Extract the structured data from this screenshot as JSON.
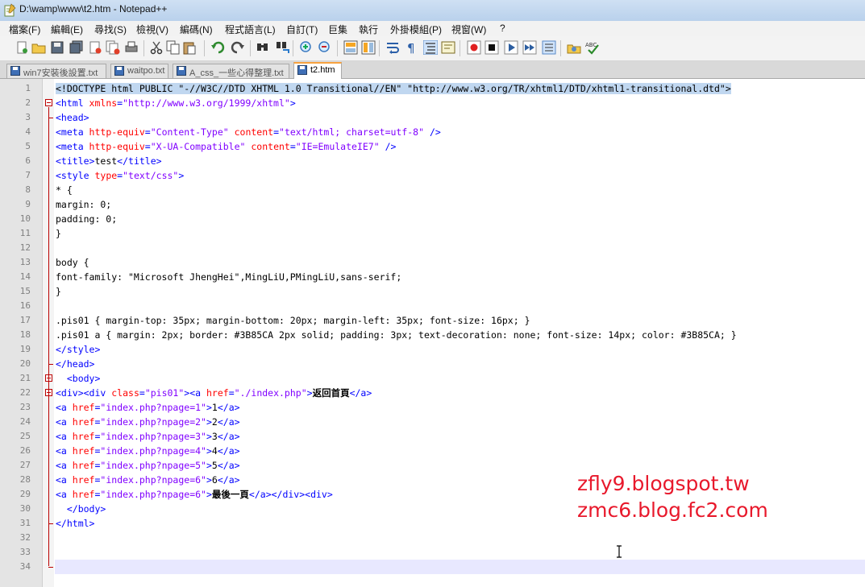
{
  "window": {
    "title": "D:\\wamp\\www\\t2.htm - Notepad++"
  },
  "menu": [
    "檔案(F)",
    "編輯(E)",
    "尋找(S)",
    "檢視(V)",
    "編碼(N)",
    "程式語言(L)",
    "自訂(T)",
    "巨集",
    "執行",
    "外掛模組(P)",
    "視窗(W)",
    "?"
  ],
  "tabs": [
    {
      "label": "win7安裝後設置.txt",
      "active": false
    },
    {
      "label": "waitpo.txt",
      "active": false
    },
    {
      "label": "A_css_一些心得整理.txt",
      "active": false
    },
    {
      "label": "t2.htm",
      "active": true
    }
  ],
  "toolbar_icons": [
    "new-file-icon",
    "open-file-icon",
    "save-icon",
    "save-all-icon",
    "close-icon",
    "close-all-icon",
    "print-icon",
    "cut-icon",
    "copy-icon",
    "paste-icon",
    "undo-icon",
    "redo-icon",
    "find-icon",
    "replace-icon",
    "zoom-in-icon",
    "zoom-out-icon",
    "sync-vertical-icon",
    "sync-horizontal-icon",
    "word-wrap-icon",
    "show-all-chars-icon",
    "indent-guide-icon",
    "user-defined-lang-icon",
    "record-macro-icon",
    "stop-macro-icon",
    "play-macro-icon",
    "run-macro-multiple-icon",
    "save-macro-icon",
    "launch-browser-icon",
    "spell-check-icon"
  ],
  "editor": {
    "lines": [
      [
        {
          "c": "sel",
          "t": "<!DOCTYPE html PUBLIC \"-//W3C//DTD XHTML 1.0 Transitional//EN\" \"http://www.w3.org/TR/xhtml1/DTD/xhtml1-transitional.dtd\">"
        }
      ],
      [
        {
          "c": "tag",
          "t": "<html "
        },
        {
          "c": "attr",
          "t": "xmlns"
        },
        {
          "c": "tag",
          "t": "="
        },
        {
          "c": "val",
          "t": "\"http://www.w3.org/1999/xhtml\""
        },
        {
          "c": "tag",
          "t": ">"
        }
      ],
      [
        {
          "c": "tag",
          "t": "<head>"
        }
      ],
      [
        {
          "c": "tag",
          "t": "<meta "
        },
        {
          "c": "attr",
          "t": "http-equiv"
        },
        {
          "c": "tag",
          "t": "="
        },
        {
          "c": "val",
          "t": "\"Content-Type\""
        },
        {
          "c": "tag",
          "t": " "
        },
        {
          "c": "attr",
          "t": "content"
        },
        {
          "c": "tag",
          "t": "="
        },
        {
          "c": "val",
          "t": "\"text/html; charset=utf-8\""
        },
        {
          "c": "tag",
          "t": " />"
        }
      ],
      [
        {
          "c": "tag",
          "t": "<meta "
        },
        {
          "c": "attr",
          "t": "http-equiv"
        },
        {
          "c": "tag",
          "t": "="
        },
        {
          "c": "val",
          "t": "\"X-UA-Compatible\""
        },
        {
          "c": "tag",
          "t": " "
        },
        {
          "c": "attr",
          "t": "content"
        },
        {
          "c": "tag",
          "t": "="
        },
        {
          "c": "val",
          "t": "\"IE=EmulateIE7\""
        },
        {
          "c": "tag",
          "t": " />"
        }
      ],
      [
        {
          "c": "tag",
          "t": "<title>"
        },
        {
          "c": "plain",
          "t": "test"
        },
        {
          "c": "tag",
          "t": "</title>"
        }
      ],
      [
        {
          "c": "tag",
          "t": "<style "
        },
        {
          "c": "attr",
          "t": "type"
        },
        {
          "c": "tag",
          "t": "="
        },
        {
          "c": "val",
          "t": "\"text/css\""
        },
        {
          "c": "tag",
          "t": ">"
        }
      ],
      [
        {
          "c": "plain",
          "t": "* {"
        }
      ],
      [
        {
          "c": "plain",
          "t": "margin: 0;"
        }
      ],
      [
        {
          "c": "plain",
          "t": "padding: 0;"
        }
      ],
      [
        {
          "c": "plain",
          "t": "}"
        }
      ],
      [],
      [
        {
          "c": "plain",
          "t": "body {"
        }
      ],
      [
        {
          "c": "plain",
          "t": "font-family: \"Microsoft JhengHei\",MingLiU,PMingLiU,sans-serif;"
        }
      ],
      [
        {
          "c": "plain",
          "t": "}"
        }
      ],
      [],
      [
        {
          "c": "plain",
          "t": ".pis01 { margin-top: 35px; margin-bottom: 20px; margin-left: 35px; font-size: 16px; }"
        }
      ],
      [
        {
          "c": "plain",
          "t": ".pis01 a { margin: 2px; border: #3B85CA 2px solid; padding: 3px; text-decoration: none; font-size: 14px; color: #3B85CA; }"
        }
      ],
      [
        {
          "c": "tag",
          "t": "</style>"
        }
      ],
      [
        {
          "c": "tag",
          "t": "</head>"
        }
      ],
      [
        {
          "c": "tag",
          "t": "  <body>"
        }
      ],
      [
        {
          "c": "tag",
          "t": "<div><div "
        },
        {
          "c": "attr",
          "t": "class"
        },
        {
          "c": "tag",
          "t": "="
        },
        {
          "c": "val",
          "t": "\"pis01\""
        },
        {
          "c": "tag",
          "t": "><a "
        },
        {
          "c": "attr",
          "t": "href"
        },
        {
          "c": "tag",
          "t": "="
        },
        {
          "c": "val",
          "t": "\"./index.php\""
        },
        {
          "c": "tag",
          "t": ">"
        },
        {
          "c": "txt",
          "t": "返回首頁"
        },
        {
          "c": "tag",
          "t": "</a>"
        }
      ],
      [
        {
          "c": "tag",
          "t": "<a "
        },
        {
          "c": "attr",
          "t": "href"
        },
        {
          "c": "tag",
          "t": "="
        },
        {
          "c": "val",
          "t": "\"index.php?npage=1\""
        },
        {
          "c": "tag",
          "t": ">"
        },
        {
          "c": "plain",
          "t": "1"
        },
        {
          "c": "tag",
          "t": "</a>"
        }
      ],
      [
        {
          "c": "tag",
          "t": "<a "
        },
        {
          "c": "attr",
          "t": "href"
        },
        {
          "c": "tag",
          "t": "="
        },
        {
          "c": "val",
          "t": "\"index.php?npage=2\""
        },
        {
          "c": "tag",
          "t": ">"
        },
        {
          "c": "plain",
          "t": "2"
        },
        {
          "c": "tag",
          "t": "</a>"
        }
      ],
      [
        {
          "c": "tag",
          "t": "<a "
        },
        {
          "c": "attr",
          "t": "href"
        },
        {
          "c": "tag",
          "t": "="
        },
        {
          "c": "val",
          "t": "\"index.php?npage=3\""
        },
        {
          "c": "tag",
          "t": ">"
        },
        {
          "c": "plain",
          "t": "3"
        },
        {
          "c": "tag",
          "t": "</a>"
        }
      ],
      [
        {
          "c": "tag",
          "t": "<a "
        },
        {
          "c": "attr",
          "t": "href"
        },
        {
          "c": "tag",
          "t": "="
        },
        {
          "c": "val",
          "t": "\"index.php?npage=4\""
        },
        {
          "c": "tag",
          "t": ">"
        },
        {
          "c": "plain",
          "t": "4"
        },
        {
          "c": "tag",
          "t": "</a>"
        }
      ],
      [
        {
          "c": "tag",
          "t": "<a "
        },
        {
          "c": "attr",
          "t": "href"
        },
        {
          "c": "tag",
          "t": "="
        },
        {
          "c": "val",
          "t": "\"index.php?npage=5\""
        },
        {
          "c": "tag",
          "t": ">"
        },
        {
          "c": "plain",
          "t": "5"
        },
        {
          "c": "tag",
          "t": "</a>"
        }
      ],
      [
        {
          "c": "tag",
          "t": "<a "
        },
        {
          "c": "attr",
          "t": "href"
        },
        {
          "c": "tag",
          "t": "="
        },
        {
          "c": "val",
          "t": "\"index.php?npage=6\""
        },
        {
          "c": "tag",
          "t": ">"
        },
        {
          "c": "plain",
          "t": "6"
        },
        {
          "c": "tag",
          "t": "</a>"
        }
      ],
      [
        {
          "c": "tag",
          "t": "<a "
        },
        {
          "c": "attr",
          "t": "href"
        },
        {
          "c": "tag",
          "t": "="
        },
        {
          "c": "val",
          "t": "\"index.php?npage=6\""
        },
        {
          "c": "tag",
          "t": ">"
        },
        {
          "c": "txt",
          "t": "最後一頁"
        },
        {
          "c": "tag",
          "t": "</a></div><div>"
        }
      ],
      [
        {
          "c": "tag",
          "t": "  </body>"
        }
      ],
      [
        {
          "c": "tag",
          "t": "</html>"
        }
      ],
      [],
      [],
      []
    ]
  },
  "watermark": [
    "zfly9.blogspot.tw",
    "zmc6.blog.fc2.com"
  ],
  "colors": {
    "tag": "#0000ff",
    "attribute": "#ff0000",
    "value": "#8000ff",
    "watermark": "#e8192c",
    "active_tab_accent": "#f7a23f"
  }
}
